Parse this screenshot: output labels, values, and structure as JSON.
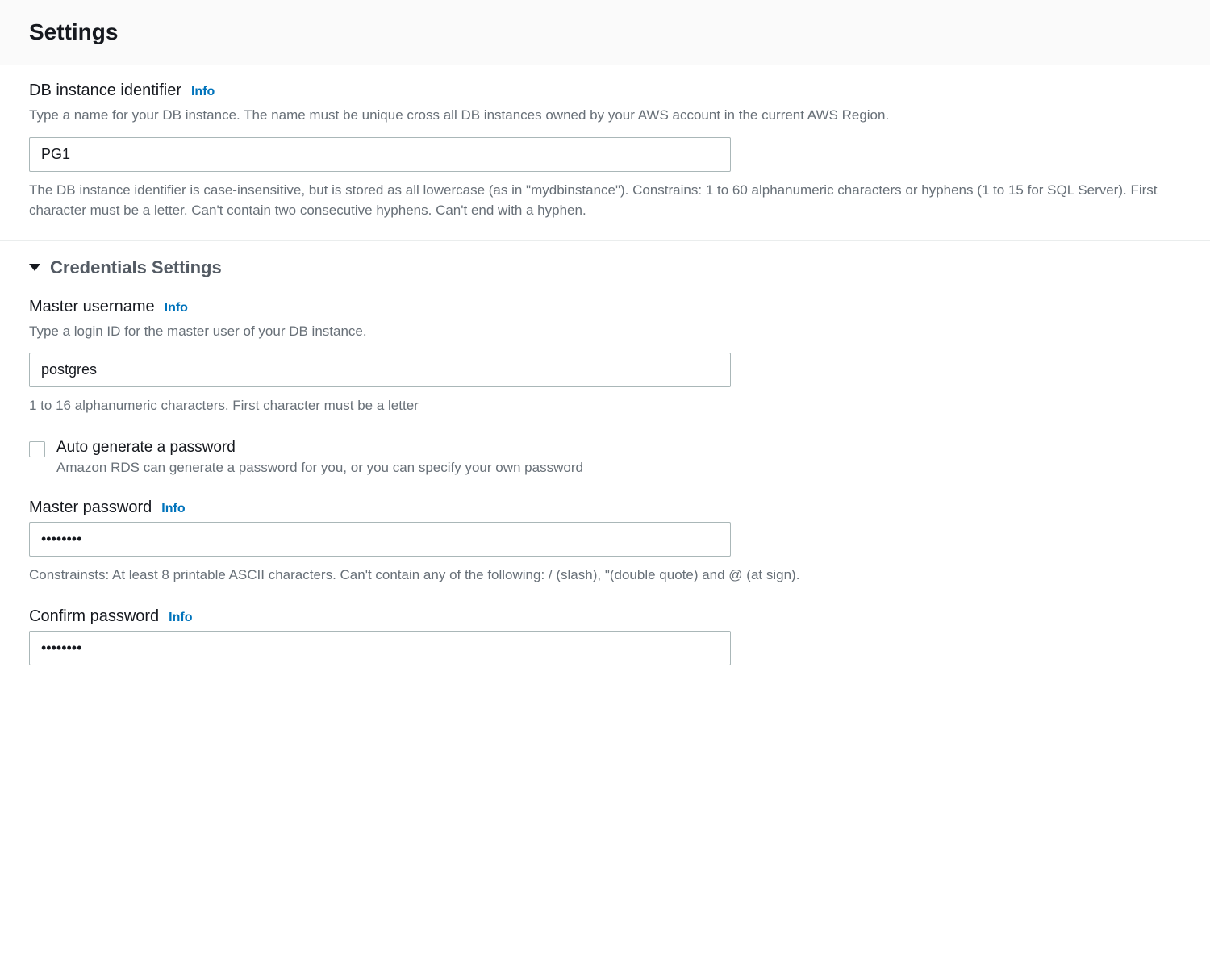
{
  "header": {
    "title": "Settings"
  },
  "db_identifier": {
    "label": "DB instance identifier",
    "info": "Info",
    "description": "Type a name for your DB instance. The name must be unique cross all DB instances owned by your AWS account in the current AWS Region.",
    "value": "PG1",
    "hint": "The DB instance identifier is case-insensitive, but is stored as all lowercase (as in \"mydbinstance\"). Constrains: 1 to 60 alphanumeric characters or hyphens (1 to 15 for SQL Server). First character must be a letter. Can't contain two consecutive hyphens. Can't end with a hyphen."
  },
  "credentials": {
    "section_title": "Credentials Settings",
    "master_username": {
      "label": "Master username",
      "info": "Info",
      "description": "Type a login ID for the master user of your DB instance.",
      "value": "postgres",
      "hint": "1 to 16 alphanumeric characters. First character must be a letter"
    },
    "auto_generate": {
      "label": "Auto generate a password",
      "description": "Amazon RDS can generate a password for you, or you can specify your own password",
      "checked": false
    },
    "master_password": {
      "label": "Master password",
      "info": "Info",
      "value": "••••••••",
      "hint": "Constrainsts: At least 8 printable ASCII characters. Can't contain any of the following: / (slash), \"(double quote) and @ (at sign)."
    },
    "confirm_password": {
      "label": "Confirm password",
      "info": "Info",
      "value": "••••••••"
    }
  }
}
